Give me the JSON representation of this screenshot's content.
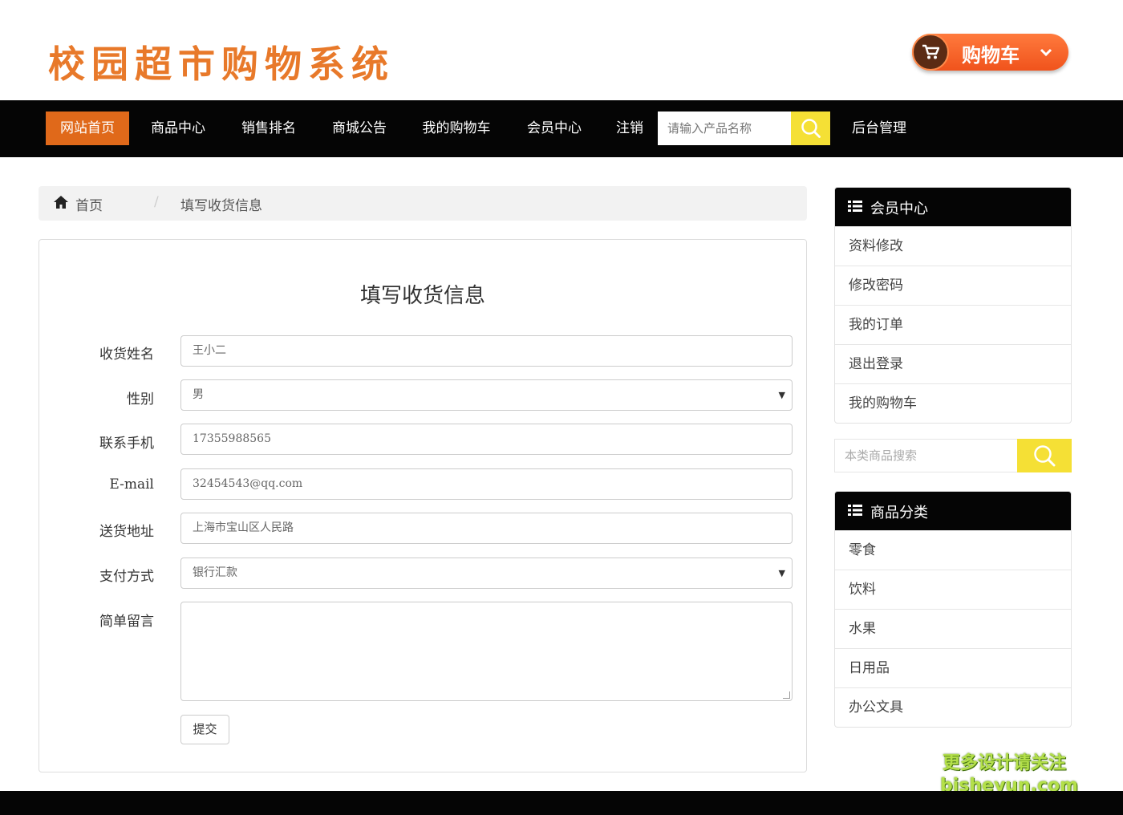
{
  "header": {
    "site_title": "校园超市购物系统",
    "cart_label": "购物车",
    "accent_color": "#e8792a"
  },
  "nav": {
    "items": [
      {
        "label": "网站首页",
        "active": true
      },
      {
        "label": "商品中心"
      },
      {
        "label": "销售排名"
      },
      {
        "label": "商城公告"
      },
      {
        "label": "我的购物车"
      },
      {
        "label": "会员中心"
      },
      {
        "label": "注销"
      }
    ],
    "search_placeholder": "请输入产品名称",
    "admin_label": "后台管理"
  },
  "breadcrumb": {
    "home": "首页",
    "separator": "/",
    "current": "填写收货信息"
  },
  "form": {
    "title": "填写收货信息",
    "fields": [
      {
        "label": "收货姓名",
        "value": "王小二"
      },
      {
        "label": "性别",
        "value": "男"
      },
      {
        "label": "联系手机",
        "value": "17355988565"
      },
      {
        "label": "E-mail",
        "value": "32454543@qq.com"
      },
      {
        "label": "送货地址",
        "value": "上海市宝山区人民路"
      },
      {
        "label": "支付方式",
        "value": "银行汇款"
      },
      {
        "label": "简单留言",
        "value": ""
      }
    ],
    "submit_label": "提交"
  },
  "sidebar": {
    "member_title": "会员中心",
    "member_items": [
      "资料修改",
      "修改密码",
      "我的订单",
      "退出登录",
      "我的购物车"
    ],
    "search_placeholder": "本类商品搜索",
    "category_title": "商品分类",
    "category_items": [
      "零食",
      "饮料",
      "水果",
      "日用品",
      "办公文具"
    ]
  },
  "watermark": {
    "line1": "更多设计请关注",
    "line2": "bisheyun.com"
  }
}
